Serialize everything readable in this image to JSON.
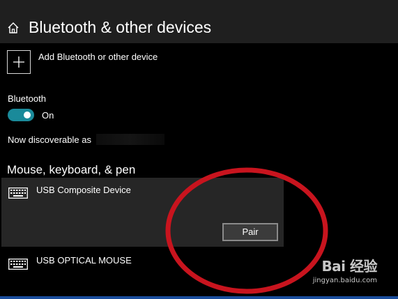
{
  "header": {
    "title": "Bluetooth & other devices",
    "home_icon": "home-icon"
  },
  "add_device": {
    "label": "Add Bluetooth or other device",
    "icon": "plus-icon"
  },
  "bluetooth": {
    "label": "Bluetooth",
    "state": "On",
    "enabled": true,
    "accent_color": "#1a8a9a"
  },
  "discoverable": {
    "label": "Now discoverable as"
  },
  "section": {
    "title": "Mouse, keyboard, & pen"
  },
  "devices": [
    {
      "name": "USB Composite Device",
      "icon": "keyboard-icon",
      "selected": true,
      "action_label": "Pair"
    },
    {
      "name": "USB OPTICAL MOUSE",
      "icon": "keyboard-icon",
      "selected": false
    }
  ],
  "annotation": {
    "shape": "ellipse",
    "color": "#c8141e"
  },
  "watermark": {
    "brand": "Bai  经验",
    "url": "jingyan.baidu.com"
  }
}
